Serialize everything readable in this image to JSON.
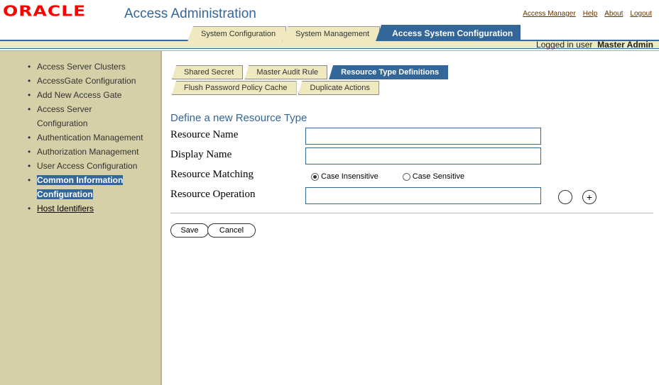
{
  "header": {
    "logo": "ORACLE",
    "app_title": "Access Administration",
    "links": [
      "Access Manager",
      "Help",
      "About",
      "Logout"
    ],
    "tabs": [
      {
        "label": "System Configuration",
        "active": false
      },
      {
        "label": "System Management",
        "active": false
      },
      {
        "label": "Access System Configuration",
        "active": true
      }
    ],
    "login_prefix": "Logged in user",
    "login_user": "Master Admin"
  },
  "sidebar": {
    "items": [
      {
        "label": "Access Server Clusters",
        "state": "normal"
      },
      {
        "label": "AccessGate Configuration",
        "state": "normal"
      },
      {
        "label": "Add New Access Gate",
        "state": "normal"
      },
      {
        "label": "Access Server Configuration",
        "state": "normal"
      },
      {
        "label": "Authentication Management",
        "state": "normal"
      },
      {
        "label": "Authorization Management",
        "state": "normal"
      },
      {
        "label": "User Access Configuration",
        "state": "normal"
      },
      {
        "label": "Common Information Configuration",
        "state": "selected"
      },
      {
        "label": "Host Identifiers",
        "state": "link"
      }
    ]
  },
  "main": {
    "subtabs_row1": [
      {
        "label": "Shared Secret",
        "active": false
      },
      {
        "label": "Master Audit Rule",
        "active": false
      },
      {
        "label": "Resource Type Definitions",
        "active": true
      }
    ],
    "subtabs_row2": [
      {
        "label": "Flush Password Policy Cache",
        "active": false
      },
      {
        "label": "Duplicate Actions",
        "active": false
      }
    ],
    "form_title": "Define a new Resource Type",
    "fields": {
      "resource_name": {
        "label": "Resource Name",
        "value": ""
      },
      "display_name": {
        "label": "Display Name",
        "value": ""
      },
      "resource_matching": {
        "label": "Resource Matching",
        "options": [
          {
            "label": "Case Insensitive",
            "checked": true
          },
          {
            "label": "Case Sensitive",
            "checked": false
          }
        ]
      },
      "resource_operation": {
        "label": "Resource Operation",
        "value": ""
      }
    },
    "buttons": {
      "save": "Save",
      "cancel": "Cancel",
      "remove_symbol": "",
      "add_symbol": "+"
    }
  }
}
